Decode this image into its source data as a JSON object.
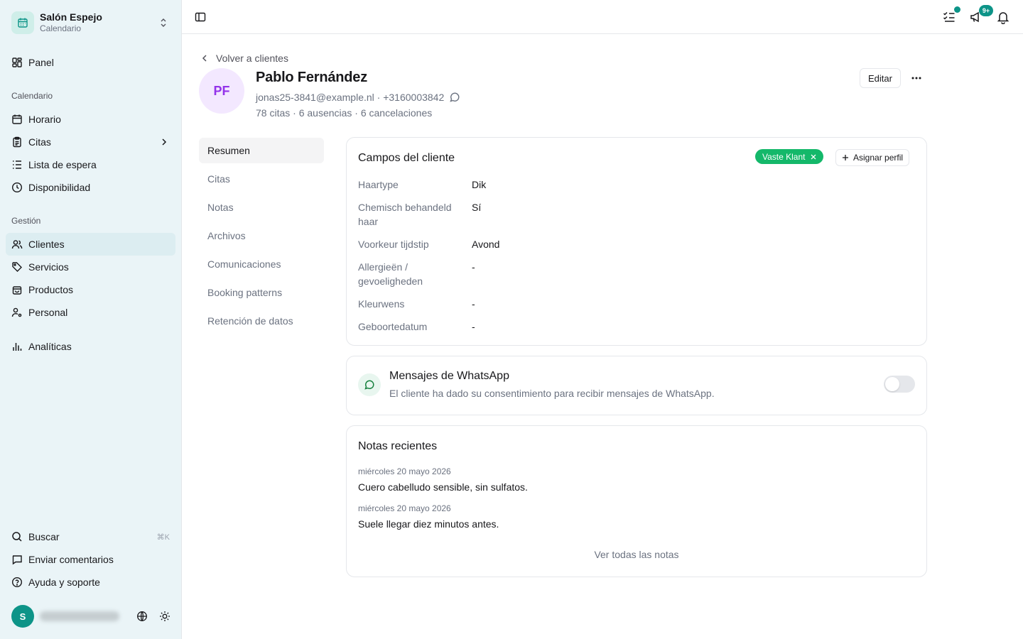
{
  "workspace": {
    "name": "Salón Espejo",
    "subtitle": "Calendario",
    "icon": "calendar-icon"
  },
  "sidebar": {
    "top": [
      {
        "label": "Panel",
        "icon": "dashboard-icon"
      }
    ],
    "section_calendar": "Calendario",
    "calendar_items": [
      {
        "label": "Horario",
        "icon": "calendar-icon"
      },
      {
        "label": "Citas",
        "icon": "clipboard-icon",
        "has_submenu": true
      },
      {
        "label": "Lista de espera",
        "icon": "list-icon"
      },
      {
        "label": "Disponibilidad",
        "icon": "clock-icon"
      }
    ],
    "section_management": "Gestión",
    "management_items": [
      {
        "label": "Clientes",
        "icon": "users-icon",
        "active": true
      },
      {
        "label": "Servicios",
        "icon": "tag-icon"
      },
      {
        "label": "Productos",
        "icon": "shopping-bag-icon"
      },
      {
        "label": "Personal",
        "icon": "user-cog-icon"
      }
    ],
    "analytics": {
      "label": "Analíticas",
      "icon": "bar-chart-icon"
    },
    "bottom_items": [
      {
        "label": "Buscar",
        "icon": "search-icon",
        "shortcut": "⌘K"
      },
      {
        "label": "Enviar comentarios",
        "icon": "message-icon"
      },
      {
        "label": "Ayuda y soporte",
        "icon": "help-circle-icon"
      }
    ],
    "user": {
      "initial": "S"
    }
  },
  "topbar": {
    "notifications_badge": "9+"
  },
  "client": {
    "back_label": "Volver a clientes",
    "initials": "PF",
    "name": "Pablo Fernández",
    "email": "jonas25-3841@example.nl",
    "separator": " · ",
    "phone": "+3160003842",
    "stats": "78 citas · 6 ausencias · 6 cancelaciones",
    "edit_label": "Editar"
  },
  "subnav": [
    {
      "label": "Resumen",
      "active": true
    },
    {
      "label": "Citas"
    },
    {
      "label": "Notas"
    },
    {
      "label": "Archivos"
    },
    {
      "label": "Comunicaciones"
    },
    {
      "label": "Booking patterns"
    },
    {
      "label": "Retención de datos"
    }
  ],
  "fields_card": {
    "title": "Campos del cliente",
    "tag": "Vaste Klant",
    "assign_label": "Asignar perfil",
    "fields": [
      {
        "label": "Haartype",
        "value": "Dik"
      },
      {
        "label": "Chemisch behandeld haar",
        "value": "Sí"
      },
      {
        "label": "Voorkeur tijdstip",
        "value": "Avond"
      },
      {
        "label": "Allergieën / gevoeligheden",
        "value": "-"
      },
      {
        "label": "Kleurwens",
        "value": "-"
      },
      {
        "label": "Geboortedatum",
        "value": "-"
      }
    ]
  },
  "whatsapp": {
    "title": "Mensajes de WhatsApp",
    "description": "El cliente ha dado su consentimiento para recibir mensajes de WhatsApp.",
    "enabled": false
  },
  "notes": {
    "title": "Notas recientes",
    "items": [
      {
        "date": "miércoles 20 mayo 2026",
        "text": "Cuero cabelludo sensible, sin sulfatos."
      },
      {
        "date": "miércoles 20 mayo 2026",
        "text": "Suele llegar diez minutos antes."
      }
    ],
    "view_all": "Ver todas las notas"
  },
  "colors": {
    "accent": "#0d9488",
    "tag": "#14b86a",
    "avatar_bg": "#f3e8ff",
    "avatar_fg": "#9333ea",
    "sidebar_bg": "#eaf4f7"
  }
}
